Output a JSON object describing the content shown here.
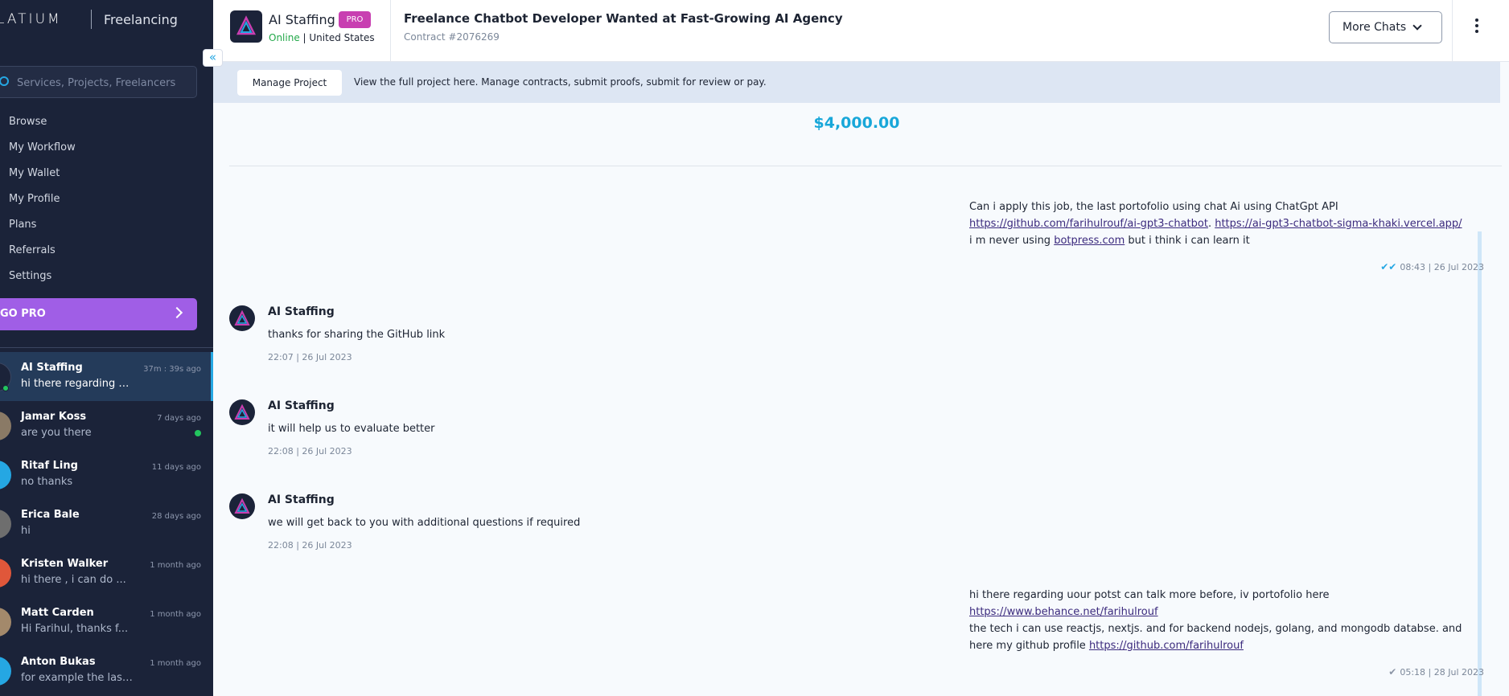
{
  "sidebar": {
    "brand": "LATIUM",
    "section": "Freelancing",
    "search_placeholder": "Services, Projects, Freelancers",
    "nav": [
      "Browse",
      "My Workflow",
      "My Wallet",
      "My Profile",
      "Plans",
      "Referrals",
      "Settings"
    ],
    "gopro_label": "GO PRO",
    "chats": [
      {
        "name": "AI Staffing",
        "message": "hi there regarding u...",
        "time": "37m : 39s ago",
        "avatar_color": "#1b2339"
      },
      {
        "name": "Jamar Koss",
        "message": "are you there",
        "time": "7 days ago",
        "avatar_color": "#8a7a66"
      },
      {
        "name": "Ritaf Ling",
        "message": "no thanks",
        "time": "11 days ago",
        "avatar_color": "#25a7e3"
      },
      {
        "name": "Erica Bale",
        "message": "hi",
        "time": "28 days ago",
        "avatar_color": "#6e6e6e"
      },
      {
        "name": "Kristen Walker",
        "message": "hi there , i can do ...",
        "time": "1 month ago",
        "avatar_color": "#e0573a"
      },
      {
        "name": "Matt Carden",
        "message": "Hi Farihul, thanks f...",
        "time": "1 month ago",
        "avatar_color": "#a3896b"
      },
      {
        "name": "Anton Bukas",
        "message": "for example the last...",
        "time": "1 month ago",
        "avatar_color": "#25a7e3"
      }
    ]
  },
  "header": {
    "contact_name": "AI Staffing",
    "pro_badge": "PRO",
    "status_online": "Online",
    "status_sep": " | ",
    "location": "United States",
    "project_title": "Freelance Chatbot Developer Wanted at Fast-Growing AI Agency",
    "contract": "Contract #2076269",
    "more_chats_label": "More Chats"
  },
  "project_bar": {
    "manage_label": "Manage Project",
    "text": "View the full project here. Manage contracts, submit proofs, submit for review or pay."
  },
  "messages": {
    "amount": "$4,000.00",
    "sent1": {
      "line1": "Can i apply this job, the last portofolio using chat Ai using ChatGpt API",
      "link1": "https://github.com/farihulrouf/ai-gpt3-chatbot",
      "sep": ". ",
      "link2": "https://ai-gpt3-chatbot-sigma-khaki.vercel.app/",
      "line3_pre": "i m never using ",
      "link3": "botpress.com",
      "line3_post": " but i think i can learn it",
      "time": "08:43 | 26 Jul 2023"
    },
    "received": [
      {
        "name": "AI Staffing",
        "text": "thanks for sharing the GitHub link",
        "time": "22:07 | 26 Jul 2023"
      },
      {
        "name": "AI Staffing",
        "text": "it will help us to evaluate better",
        "time": "22:08 | 26 Jul 2023"
      },
      {
        "name": "AI Staffing",
        "text": "we will get back to you with additional questions if required",
        "time": "22:08 | 26 Jul 2023"
      }
    ],
    "sent2": {
      "line1": "hi there regarding uour potst can talk more before, iv portofolio here",
      "link1": "https://www.behance.net/farihulrouf",
      "line3": "the tech i can use reactjs, nextjs. and for backend nodejs, golang, and mongodb databse. and",
      "line4_pre": "here my github profile ",
      "link4": "https://github.com/farihulrouf",
      "time": "05:18 | 28 Jul 2023"
    }
  },
  "colors": {
    "sidebar_bg": "#1b2339",
    "accent": "#25a7e3",
    "gopro": "#a05ee6",
    "pro_badge": "#c83fb1",
    "online": "#22a849",
    "amount": "#18a7d9"
  }
}
